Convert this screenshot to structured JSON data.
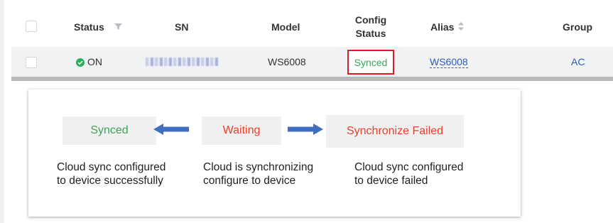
{
  "table": {
    "headers": {
      "status": "Status",
      "sn": "SN",
      "model": "Model",
      "config_status_line1": "Config",
      "config_status_line2": "Status",
      "alias": "Alias",
      "group": "Group"
    },
    "row": {
      "status": "ON",
      "model": "WS6008",
      "config_status": "Synced",
      "alias": "WS6008",
      "group": "AC"
    }
  },
  "legend": {
    "synced": {
      "label": "Synced",
      "description_line1": "Cloud sync configured",
      "description_line2": "to device successfully"
    },
    "waiting": {
      "label": "Waiting",
      "description_line1": "Cloud is synchronizing",
      "description_line2": "configure to device"
    },
    "failed": {
      "label": "Synchronize Failed",
      "description_line1": "Cloud sync configured",
      "description_line2": "to device failed"
    }
  },
  "colors": {
    "synced_text": "#3aa655",
    "waiting_text": "#e8402a",
    "failed_text": "#e8402a",
    "highlight_border": "#e01b24",
    "arrow": "#3e6fc2",
    "link": "#2b5ac8",
    "status_on": "#27b05a"
  },
  "icons": [
    "filter-icon",
    "sort-icon",
    "check-circle-icon",
    "arrow-left-icon",
    "arrow-right-icon"
  ]
}
